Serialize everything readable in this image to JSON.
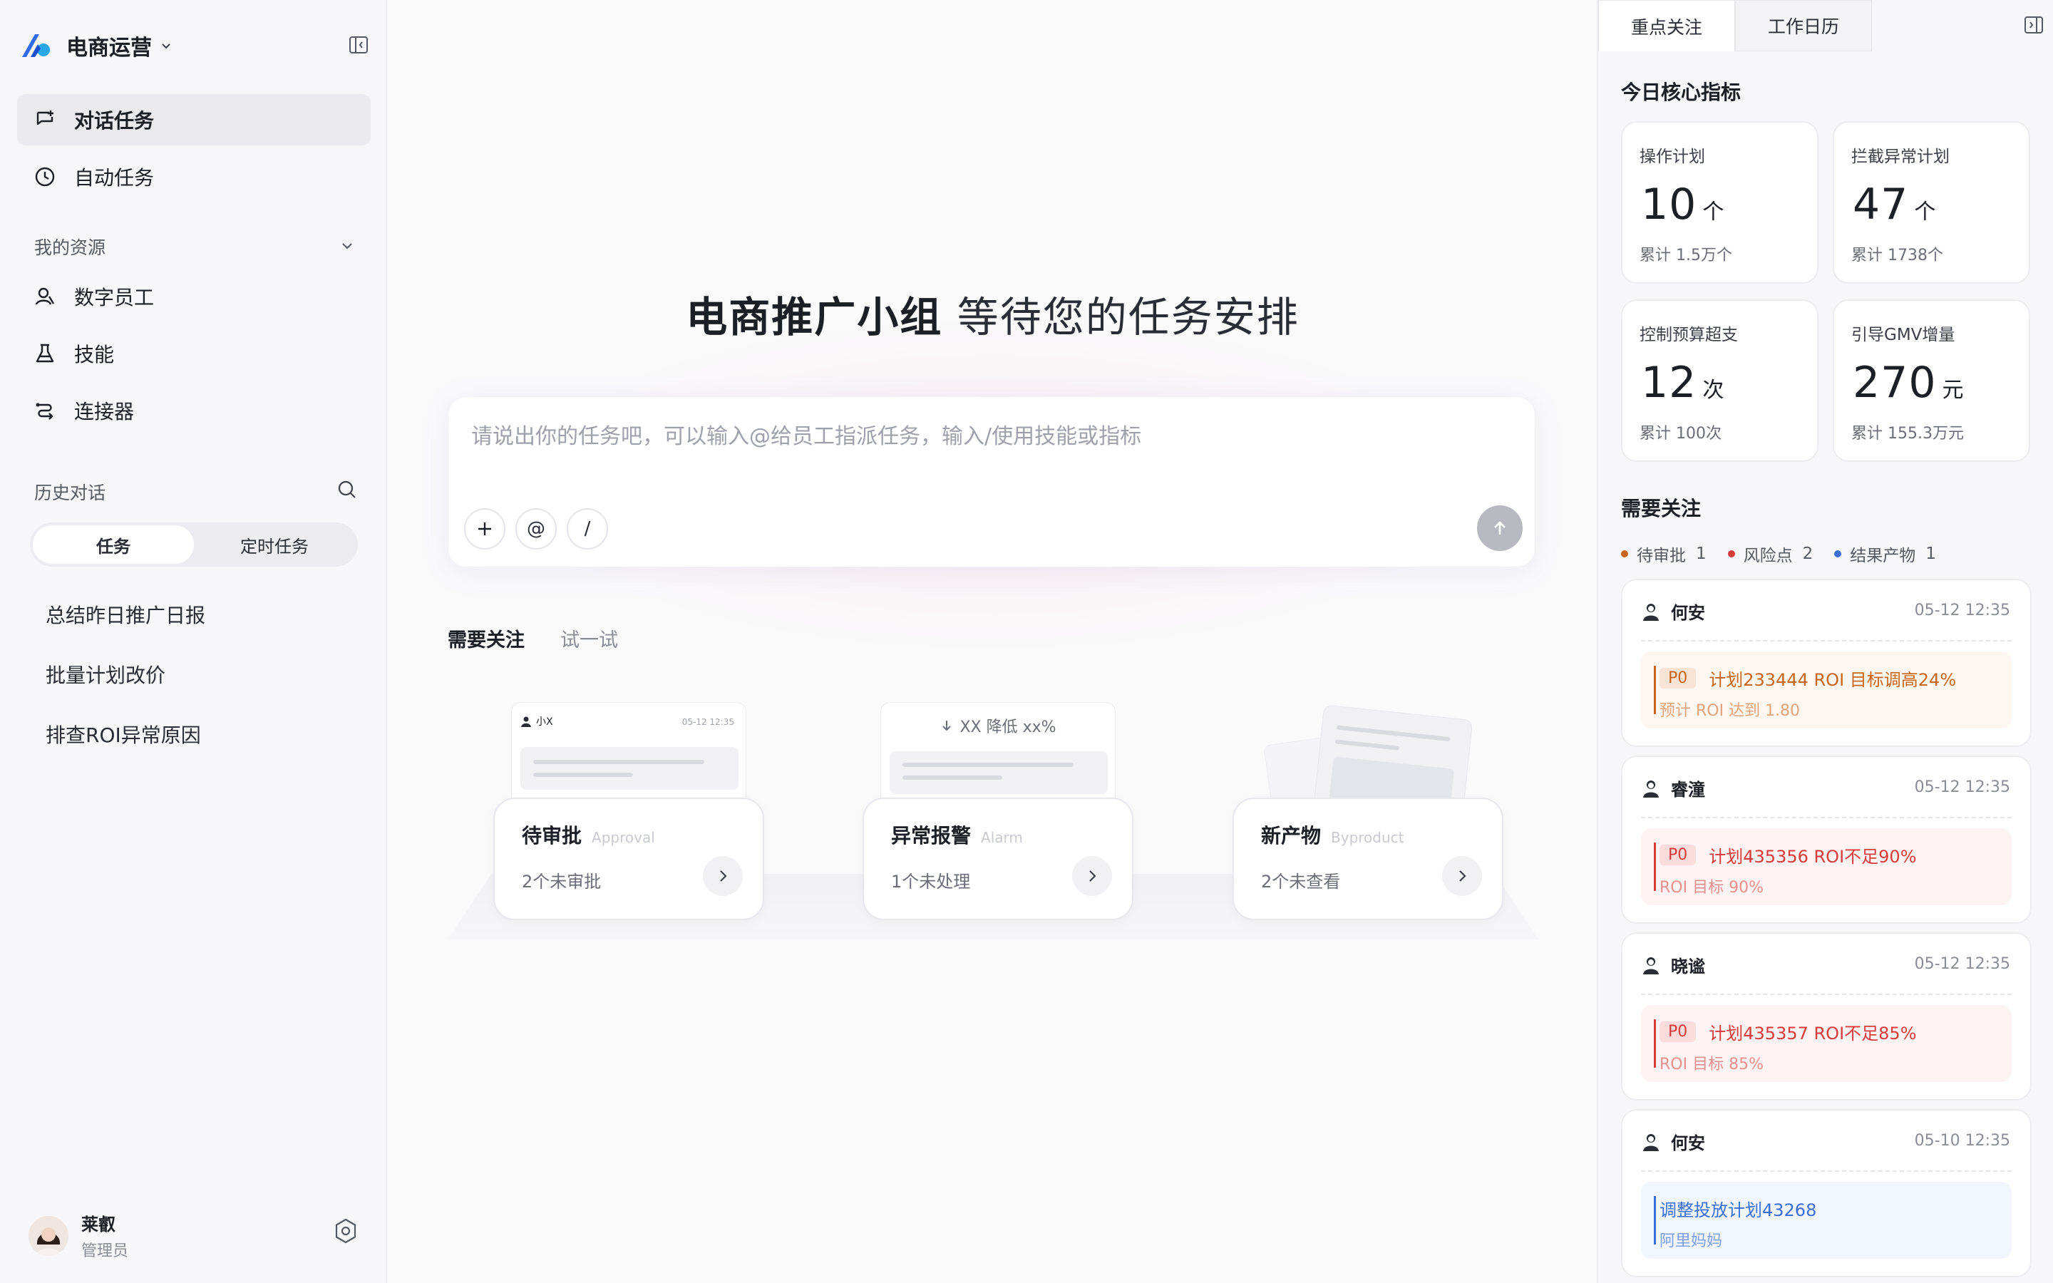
{
  "brand": {
    "name": "电商运营"
  },
  "nav": {
    "chat_task": "对话任务",
    "auto_task": "自动任务"
  },
  "resources": {
    "title": "我的资源",
    "items": [
      "数字员工",
      "技能",
      "连接器"
    ]
  },
  "history": {
    "title": "历史对话",
    "seg": [
      "任务",
      "定时任务"
    ],
    "items": [
      "总结昨日推广日报",
      "批量计划改价",
      "排查ROI异常原因"
    ]
  },
  "user": {
    "name": "莱叡",
    "role": "管理员"
  },
  "hero": {
    "bold": "电商推广小组",
    "rest": " 等待您的任务安排"
  },
  "composer": {
    "placeholder": "请说出你的任务吧，可以输入@给员工指派任务，输入/使用技能或指标",
    "at": "@",
    "slash": "/"
  },
  "main_tabs": [
    "需要关注",
    "试一试"
  ],
  "cards": [
    {
      "title": "待审批",
      "en": "Approval",
      "sub": "2个未审批",
      "mini_user": "小X",
      "mini_time": "05-12 12:35"
    },
    {
      "title": "异常报警",
      "en": "Alarm",
      "sub": "1个未处理",
      "mini_text": "XX 降低 xx%"
    },
    {
      "title": "新产物",
      "en": "Byproduct",
      "sub": "2个未查看"
    }
  ],
  "panel": {
    "tabs": [
      "重点关注",
      "工作日历"
    ],
    "metrics_title": "今日核心指标",
    "metrics": [
      {
        "label": "操作计划",
        "value": "10",
        "unit": "个",
        "sub": "累计 1.5万个"
      },
      {
        "label": "拦截异常计划",
        "value": "47",
        "unit": "个",
        "sub": "累计 1738个"
      },
      {
        "label": "控制预算超支",
        "value": "12",
        "unit": "次",
        "sub": "累计 100次"
      },
      {
        "label": "引导GMV增量",
        "value": "270",
        "unit": "元",
        "sub": "累计 155.3万元"
      }
    ],
    "attention_title": "需要关注",
    "legend": [
      {
        "label": "待审批",
        "count": "1",
        "color": "#c8651b"
      },
      {
        "label": "风险点",
        "count": "2",
        "color": "#d93a3a"
      },
      {
        "label": "结果产物",
        "count": "1",
        "color": "#3a6fd9"
      }
    ],
    "feed": [
      {
        "name": "何安",
        "time": "05-12 12:35",
        "tag": "P0",
        "line1": "计划233444 ROI 目标调高24%",
        "line2": "预计 ROI 达到 1.80",
        "accent": "#c8651b"
      },
      {
        "name": "睿潼",
        "time": "05-12 12:35",
        "tag": "P0",
        "line1": "计划435356 ROI不足90%",
        "line2": "ROI 目标 90%",
        "accent": "#d93a3a"
      },
      {
        "name": "晓谧",
        "time": "05-12 12:35",
        "tag": "P0",
        "line1": "计划435357 ROI不足85%",
        "line2": "ROI 目标 85%",
        "accent": "#d93a3a"
      },
      {
        "name": "何安",
        "time": "05-10 12:35",
        "tag": "",
        "line1": "调整投放计划43268",
        "line2": "阿里妈妈",
        "accent": "#3a6fd9"
      }
    ]
  }
}
